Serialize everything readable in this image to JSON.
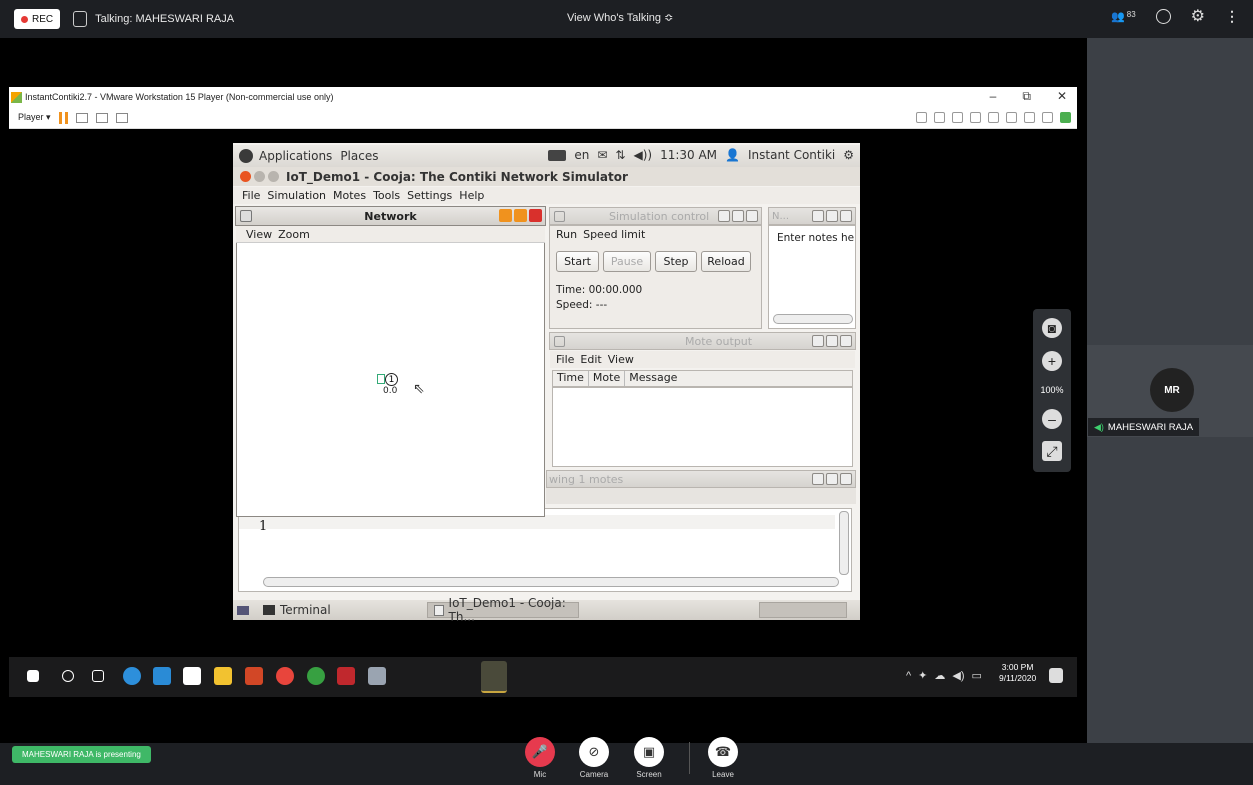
{
  "meeting": {
    "rec_label": "REC",
    "talking": "Talking: MAHESWARI RAJA",
    "view_who": "View Who's Talking ≎",
    "participant_count": "83",
    "presenting": "MAHESWARI RAJA is presenting",
    "participant": {
      "initials": "MR",
      "name": "MAHESWARI RAJA"
    },
    "controls": [
      {
        "label": "Mic",
        "icon": "mic-off-icon"
      },
      {
        "label": "Camera",
        "icon": "camera-off-icon"
      },
      {
        "label": "Screen",
        "icon": "screen-share-icon"
      },
      {
        "label": "Leave",
        "icon": "phone-hangup-icon"
      }
    ],
    "zoom_level": "100%"
  },
  "vmware": {
    "title": "InstantContiki2.7 - VMware Workstation 15 Player (Non-commercial use only)",
    "player_label": "Player ▾",
    "win_buttons": [
      "–",
      "⧉",
      "✕"
    ]
  },
  "ubuntu": {
    "top_menu": [
      "Applications",
      "Places"
    ],
    "lang": "en",
    "clock": "11:30 AM",
    "user": "Instant Contiki",
    "taskbar": [
      "Terminal",
      "IoT_Demo1 - Cooja: Th..."
    ]
  },
  "cooja": {
    "window_title": "IoT_Demo1 - Cooja: The Contiki Network Simulator",
    "menu": [
      "File",
      "Simulation",
      "Motes",
      "Tools",
      "Settings",
      "Help"
    ],
    "network": {
      "title": "Network",
      "menu": [
        "View",
        "Zoom"
      ],
      "mote_id": "1",
      "mote_coords": "0.0"
    },
    "sim_control": {
      "title": "Simulation control",
      "menu": [
        "Run",
        "Speed limit"
      ],
      "buttons": [
        "Start",
        "Pause",
        "Step",
        "Reload"
      ],
      "time": "Time: 00:00.000",
      "speed": "Speed: ---"
    },
    "notes": {
      "title": "N...",
      "placeholder": "Enter notes he"
    },
    "mote_output": {
      "title": "Mote output",
      "menu": [
        "File",
        "Edit",
        "View"
      ],
      "columns": [
        "Time",
        "Mote",
        "Message"
      ]
    },
    "timeline": {
      "title": "wing 1 motes",
      "row_label": "1"
    }
  },
  "windows": {
    "time": "3:00 PM",
    "date": "9/11/2020"
  },
  "colors": {
    "accent_green": "#3fb867",
    "leave_red": "#e63a4e",
    "rec_red": "#e53935"
  }
}
